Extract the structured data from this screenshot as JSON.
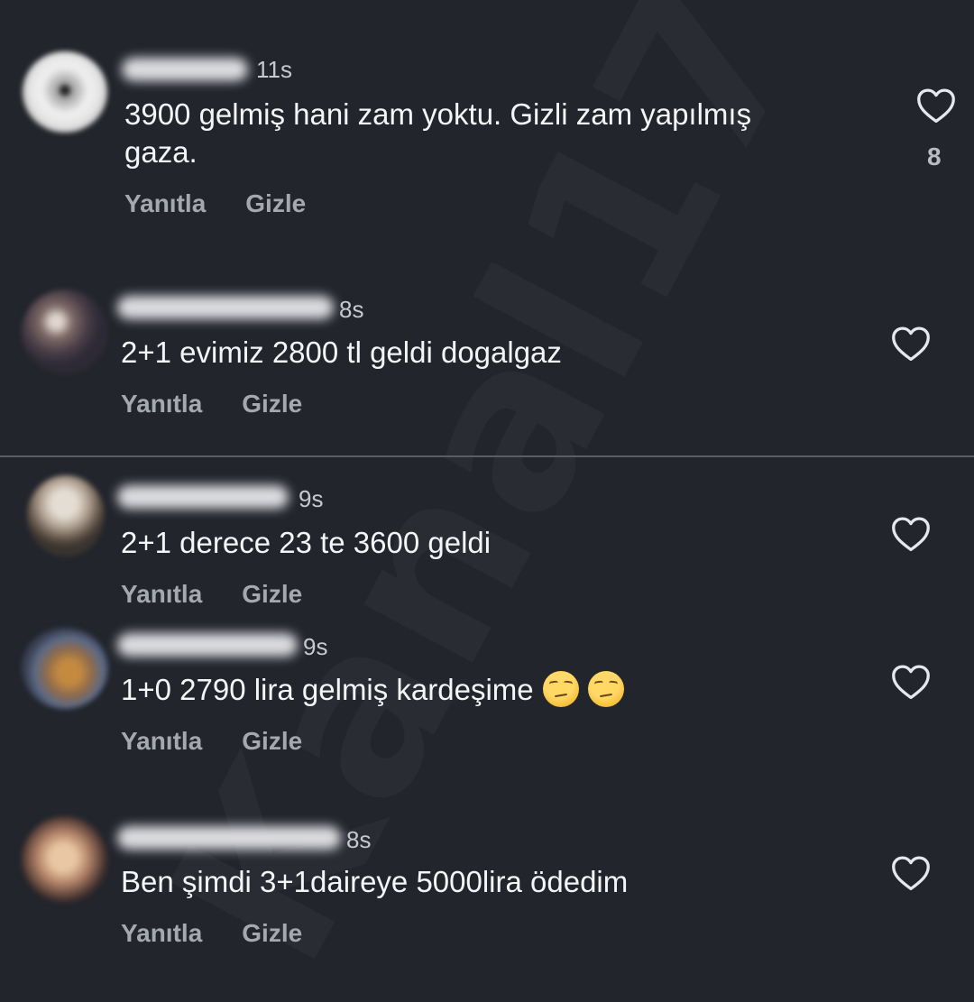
{
  "watermark": "Kanal17",
  "comments": [
    {
      "time": "11s",
      "text_line1": "3900 gelmiş hani zam yoktu. Gizli zam yapılmış",
      "text_line2": "gaza.",
      "reply_label": "Yanıtla",
      "hide_label": "Gizle",
      "like_count": "8"
    },
    {
      "time": "8s",
      "text": "2+1  evimiz 2800 tl geldi dogalgaz",
      "reply_label": "Yanıtla",
      "hide_label": "Gizle"
    },
    {
      "time": "9s",
      "text": "2+1 derece 23 te 3600 geldi",
      "reply_label": "Yanıtla",
      "hide_label": "Gizle"
    },
    {
      "time": "9s",
      "text": "1+0 2790 lira gelmiş kardeşime",
      "emojis": [
        "unamused-face",
        "unamused-face"
      ],
      "reply_label": "Yanıtla",
      "hide_label": "Gizle"
    },
    {
      "time": "8s",
      "text": "Ben şimdi 3+1daireye 5000lira ödedim",
      "reply_label": "Yanıtla",
      "hide_label": "Gizle"
    }
  ],
  "colors": {
    "background": "#22252c",
    "text": "#f4f5f7",
    "secondary_text": "#a5a8b0",
    "divider": "#5a5d64"
  }
}
